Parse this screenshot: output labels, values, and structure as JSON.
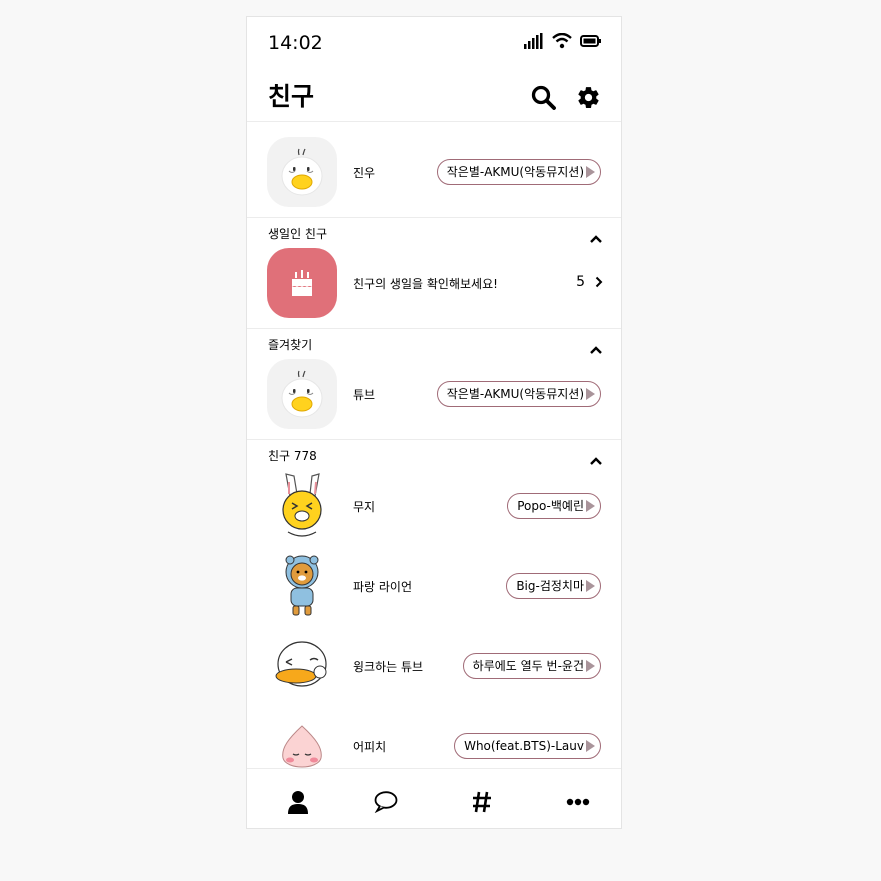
{
  "status": {
    "time": "14:02"
  },
  "header": {
    "title": "친구"
  },
  "profile": {
    "name": "진우",
    "music": "작은별-AKMU(악동뮤지션)"
  },
  "birthday": {
    "label": "생일인 친구",
    "text": "친구의 생일을 확인해보세요!",
    "count": "5"
  },
  "favorites": {
    "label": "즐겨찾기",
    "items": [
      {
        "name": "튜브",
        "music": "작은별-AKMU(악동뮤지션)"
      }
    ]
  },
  "friends": {
    "label": "친구 778",
    "items": [
      {
        "name": "무지",
        "music": "Popo-백예린"
      },
      {
        "name": "파랑 라이언",
        "music": "Big-검정치마"
      },
      {
        "name": "윙크하는 튜브",
        "music": "하루에도 열두 번-윤건"
      },
      {
        "name": "어피치",
        "music": "Who(feat.BTS)-Lauv"
      }
    ]
  },
  "colors": {
    "birthday_bg": "#e07079",
    "music_border": "#a06b77"
  },
  "icons": {
    "search": "search-icon",
    "settings": "gear-icon",
    "tabs": [
      "person-icon",
      "chat-bubble-icon",
      "hashtag-icon",
      "more-icon"
    ]
  }
}
